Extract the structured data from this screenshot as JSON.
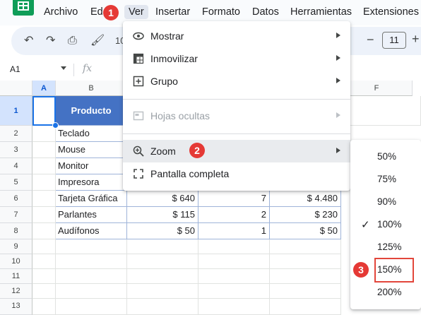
{
  "menubar": {
    "items": [
      "Archivo",
      "Ed",
      "Ver",
      "Insertar",
      "Formato",
      "Datos",
      "Herramientas",
      "Extensiones"
    ]
  },
  "toolbar": {
    "undo_icon": "undo-icon",
    "redo_icon": "redo-icon",
    "print_icon": "print-icon",
    "paint_format_icon": "paint-format-icon",
    "zoom_partial": "10",
    "font_size": "11",
    "minus": "−",
    "plus": "+"
  },
  "formula_bar": {
    "name_box": "A1",
    "fx": "fx"
  },
  "columns": [
    "A",
    "B",
    "F"
  ],
  "rows": [
    "1",
    "2",
    "3",
    "4",
    "5",
    "6",
    "7",
    "8",
    "9",
    "10",
    "11",
    "12",
    "13"
  ],
  "table": {
    "header": "Producto",
    "rows": [
      {
        "product": "Teclado",
        "price": "",
        "qty": "",
        "total": ""
      },
      {
        "product": "Mouse",
        "price": "",
        "qty": "",
        "total": ""
      },
      {
        "product": "Monitor",
        "price": "",
        "qty": "",
        "total": ""
      },
      {
        "product": "Impresora",
        "price": "",
        "qty": "",
        "total": ""
      },
      {
        "product": "Tarjeta Gráfica",
        "price": "$ 640",
        "qty": "7",
        "total": "$ 4.480"
      },
      {
        "product": "Parlantes",
        "price": "$ 115",
        "qty": "2",
        "total": "$ 230"
      },
      {
        "product": "Audífonos",
        "price": "$ 50",
        "qty": "1",
        "total": "$ 50"
      }
    ]
  },
  "view_menu": {
    "items": [
      {
        "label": "Mostrar",
        "icon": "eye-icon",
        "submenu": true,
        "disabled": false
      },
      {
        "label": "Inmovilizar",
        "icon": "freeze-icon",
        "submenu": true,
        "disabled": false
      },
      {
        "label": "Grupo",
        "icon": "group-icon",
        "submenu": true,
        "disabled": false
      },
      {
        "label": "Hojas ocultas",
        "icon": "hidden-sheets-icon",
        "submenu": true,
        "disabled": true
      },
      {
        "label": "Zoom",
        "icon": "zoom-icon",
        "submenu": true,
        "disabled": false,
        "highlighted": true
      },
      {
        "label": "Pantalla completa",
        "icon": "fullscreen-icon",
        "submenu": false,
        "disabled": false
      }
    ]
  },
  "zoom_menu": {
    "options": [
      "50%",
      "75%",
      "90%",
      "100%",
      "125%",
      "150%",
      "200%"
    ],
    "checked": "100%",
    "highlighted": "150%"
  },
  "badges": [
    "1",
    "2",
    "3"
  ],
  "colors": {
    "table_header": "#4472c4",
    "badge": "#e53935",
    "selection": "#1a73e8",
    "sheets_green": "#0f9d58"
  }
}
